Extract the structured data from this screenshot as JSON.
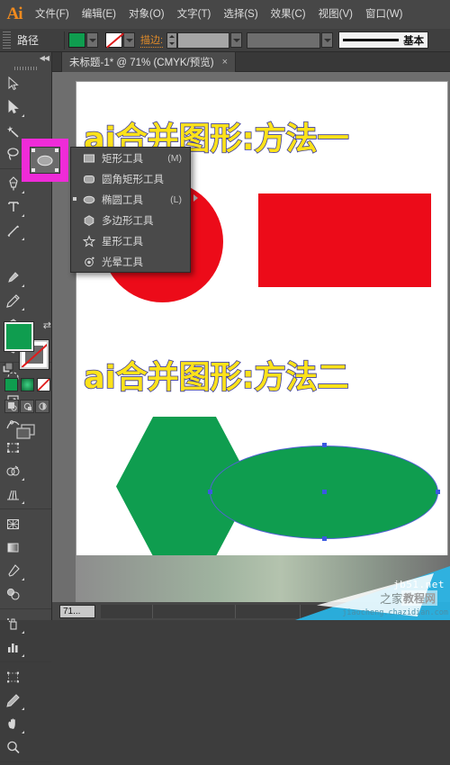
{
  "app": {
    "logo": "Ai",
    "menus": [
      {
        "label": "文件(F)"
      },
      {
        "label": "编辑(E)"
      },
      {
        "label": "对象(O)"
      },
      {
        "label": "文字(T)"
      },
      {
        "label": "选择(S)"
      },
      {
        "label": "效果(C)"
      },
      {
        "label": "视图(V)"
      },
      {
        "label": "窗口(W)"
      }
    ]
  },
  "control_bar": {
    "object_label": "路径",
    "fill_color": "#0f9d4f",
    "stroke_color": "none",
    "stroke_label": "描边:",
    "stroke_weight_value": "",
    "profile_value": "",
    "brush_label": "基本"
  },
  "tools": {
    "rows": [
      [
        {
          "name": "selection-tool"
        },
        {
          "name": "direct-selection-tool"
        }
      ],
      [
        {
          "name": "magic-wand-tool"
        },
        {
          "name": "lasso-tool"
        }
      ],
      [
        {
          "name": "pen-tool"
        },
        {
          "name": "type-tool"
        }
      ],
      [
        {
          "name": "line-segment-tool"
        },
        {
          "name": "ellipse-shape-tool"
        }
      ],
      [
        {
          "name": "paintbrush-tool"
        },
        {
          "name": "pencil-tool"
        }
      ],
      [
        {
          "name": "blob-brush-tool"
        },
        {
          "name": "eraser-tool"
        }
      ],
      [
        {
          "name": "rotate-tool"
        },
        {
          "name": "scale-tool"
        }
      ],
      [
        {
          "name": "width-tool"
        },
        {
          "name": "free-transform-tool"
        }
      ],
      [
        {
          "name": "shape-builder-tool"
        },
        {
          "name": "perspective-grid-tool"
        }
      ],
      [
        {
          "name": "mesh-tool"
        },
        {
          "name": "gradient-tool"
        }
      ],
      [
        {
          "name": "eyedropper-tool"
        },
        {
          "name": "blend-tool"
        }
      ],
      [
        {
          "name": "symbol-sprayer-tool"
        },
        {
          "name": "column-graph-tool"
        }
      ],
      [
        {
          "name": "artboard-tool"
        },
        {
          "name": "slice-tool"
        }
      ],
      [
        {
          "name": "hand-tool"
        },
        {
          "name": "zoom-tool"
        }
      ]
    ],
    "selected": "ellipse-shape-tool",
    "highlight_color": "#ef2bd8",
    "fill_swatch": "#0f9d4f",
    "stroke_swatch": "none"
  },
  "flyout_menu": {
    "items": [
      {
        "label": "矩形工具",
        "shortcut": "(M)",
        "icon": "rectangle-icon",
        "active": false
      },
      {
        "label": "圆角矩形工具",
        "shortcut": "",
        "icon": "rounded-rectangle-icon",
        "active": false
      },
      {
        "label": "椭圆工具",
        "shortcut": "(L)",
        "icon": "ellipse-icon",
        "active": true
      },
      {
        "label": "多边形工具",
        "shortcut": "",
        "icon": "polygon-icon",
        "active": false
      },
      {
        "label": "星形工具",
        "shortcut": "",
        "icon": "star-icon",
        "active": false
      },
      {
        "label": "光晕工具",
        "shortcut": "",
        "icon": "flare-icon",
        "active": false
      }
    ]
  },
  "document": {
    "tab_title": "未标题-1* @ 71% (CMYK/预览)",
    "close_label": "×",
    "headings": [
      {
        "text": "ai合并图形:方法一"
      },
      {
        "text": "ai合并图形:方法二"
      }
    ],
    "shapes": [
      {
        "name": "red-circle",
        "color": "#ec0b19",
        "type": "circle"
      },
      {
        "name": "red-rectangle",
        "color": "#ec0b19",
        "type": "rectangle"
      },
      {
        "name": "green-hexagon",
        "color": "#0f9d4f",
        "type": "hexagon"
      },
      {
        "name": "green-ellipse",
        "color": "#0f9d4f",
        "type": "ellipse",
        "selected": true
      }
    ],
    "heading_fill": "#fde21a",
    "heading_stroke": "#3b3b9e"
  },
  "status_bar": {
    "zoom": "71..."
  },
  "watermark": {
    "site": "jb51.net",
    "cn_label": "教程网",
    "url": "jiaocheng.chazidian.com",
    "faint": "之家"
  }
}
